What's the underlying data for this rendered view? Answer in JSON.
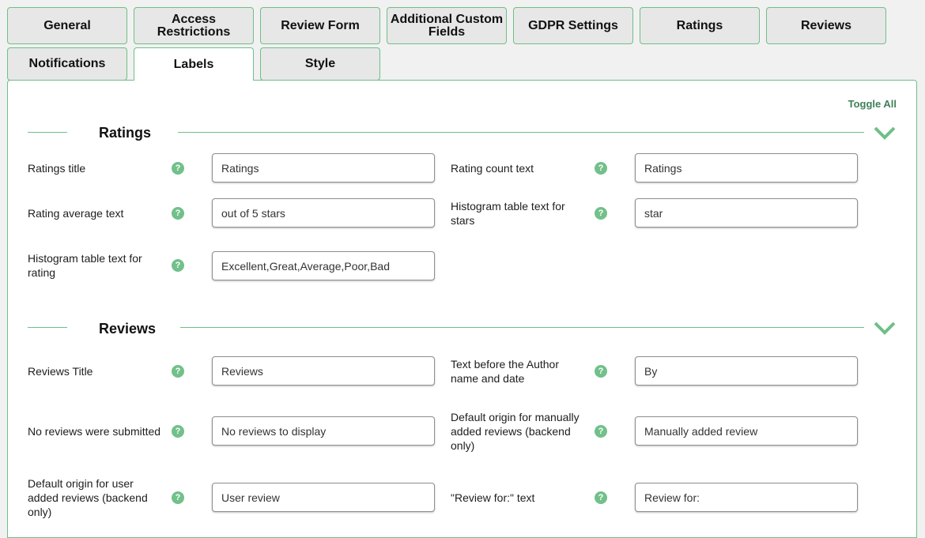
{
  "tabs": [
    {
      "label": "General"
    },
    {
      "label": "Access Restrictions"
    },
    {
      "label": "Review Form"
    },
    {
      "label": "Additional Custom Fields"
    },
    {
      "label": "GDPR Settings"
    },
    {
      "label": "Ratings"
    },
    {
      "label": "Reviews"
    },
    {
      "label": "Notifications"
    },
    {
      "label": "Labels"
    },
    {
      "label": "Style"
    }
  ],
  "active_tab": "Labels",
  "toggle_all": "Toggle All",
  "help_glyph": "?",
  "colors": {
    "accent": "#6fbf87",
    "help": "#72c08a",
    "toggle_text": "#3f7f59",
    "tab_bg": "#e7e7e7"
  },
  "ratings": {
    "title": "Ratings",
    "fields": {
      "ratings_title": {
        "label": "Ratings title",
        "value": "Ratings"
      },
      "rating_count_text": {
        "label": "Rating count text",
        "value": "Ratings"
      },
      "rating_average_text": {
        "label": "Rating average text",
        "value": "out of 5 stars"
      },
      "histogram_stars": {
        "label": "Histogram table text for stars",
        "value": "star"
      },
      "histogram_rating": {
        "label": "Histogram table text for rating",
        "value": "Excellent,Great,Average,Poor,Bad"
      }
    }
  },
  "reviews": {
    "title": "Reviews",
    "fields": {
      "reviews_title": {
        "label": "Reviews Title",
        "value": "Reviews"
      },
      "text_before_author": {
        "label": "Text before the Author name and date",
        "value": "By"
      },
      "no_reviews": {
        "label": "No reviews were submitted",
        "value": "No reviews to display"
      },
      "default_origin_manual": {
        "label": "Default origin for manually added reviews (backend only)",
        "value": "Manually added review"
      },
      "default_origin_user": {
        "label": "Default origin for user added reviews (backend only)",
        "value": "User review"
      },
      "review_for_text": {
        "label": "\"Review for:\" text",
        "value": "Review for:"
      }
    }
  }
}
